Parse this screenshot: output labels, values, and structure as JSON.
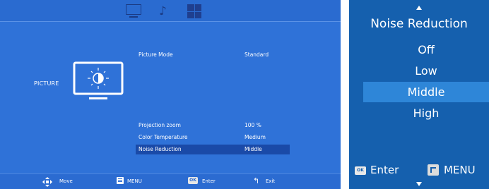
{
  "left_osd": {
    "top_icons": [
      "tv-icon",
      "music-note-icon",
      "grid-icon"
    ],
    "category_label": "PICTURE",
    "rows": [
      {
        "label": "Picture Mode",
        "value": "Standard",
        "selected": false
      },
      {
        "label": "Projection zoom",
        "value": "100 %",
        "selected": false
      },
      {
        "label": "Color Temperature",
        "value": "Medium",
        "selected": false
      },
      {
        "label": "Noise Reduction",
        "value": "Middle",
        "selected": true
      }
    ],
    "hints": [
      {
        "icon": "move-arrows-icon",
        "label": "Move"
      },
      {
        "icon": "menu-icon",
        "label": "MENU"
      },
      {
        "icon": "ok-icon",
        "label": "Enter",
        "icon_text": "OK"
      },
      {
        "icon": "exit-icon",
        "label": "Exit"
      }
    ],
    "colors": {
      "background": "#2f72d8",
      "selected_row": "#1a4aa8"
    }
  },
  "right_osd": {
    "title": "Noise Reduction",
    "options": [
      {
        "label": "Off",
        "selected": false
      },
      {
        "label": "Low",
        "selected": false
      },
      {
        "label": "Middle",
        "selected": true
      },
      {
        "label": "High",
        "selected": false
      }
    ],
    "hints": [
      {
        "icon": "ok-icon",
        "label": "Enter",
        "icon_text": "OK"
      },
      {
        "icon": "menu-icon",
        "label": "MENU"
      }
    ],
    "colors": {
      "background": "#1560ae",
      "selected_option": "#2e86d8"
    }
  }
}
